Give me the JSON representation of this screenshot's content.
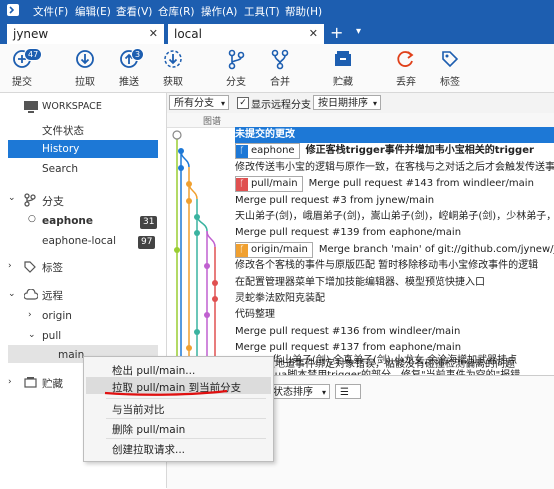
{
  "menubar": {
    "items": [
      "文件(F)",
      "编辑(E)",
      "查看(V)",
      "仓库(R)",
      "操作(A)",
      "工具(T)",
      "帮助(H)"
    ],
    "bg": "#1d5eb0"
  },
  "tabs": [
    {
      "label": "jynew",
      "close": "✕"
    },
    {
      "label": "local",
      "close": "✕"
    }
  ],
  "new_tab": "+",
  "tab_menu": "▾",
  "toolbar": {
    "commit": {
      "label": "提交",
      "badge": "47"
    },
    "pull": {
      "label": "拉取"
    },
    "push": {
      "label": "推送",
      "badge": "3"
    },
    "fetch": {
      "label": "获取"
    },
    "branch": {
      "label": "分支"
    },
    "merge": {
      "label": "合并"
    },
    "stash": {
      "label": "贮藏"
    },
    "discard": {
      "label": "丢弃"
    },
    "tag": {
      "label": "标签"
    }
  },
  "sidebar": {
    "workspace": "WORKSPACE",
    "file_status": "文件状态",
    "history": "History",
    "search": "Search",
    "branches_header": "分支",
    "branches": [
      {
        "name": "eaphone",
        "count": "31"
      },
      {
        "name": "eaphone-local",
        "count": "97"
      }
    ],
    "tags_header": "标签",
    "remotes_header": "远程",
    "remote_origin": "origin",
    "remote_pull": "pull",
    "remote_pull_main": "main",
    "stash_header": "贮藏"
  },
  "filter": {
    "branches": "所有分支",
    "show_remote": "显示远程分支",
    "sort": "按日期排序"
  },
  "columns": {
    "graph": "图谱"
  },
  "commits": [
    {
      "text": "未提交的更改",
      "selected": true
    },
    {
      "ref": "eaphone",
      "text": "修正客栈trigger事件并增加韦小宝相关的trigger",
      "bold": true
    },
    {
      "text": "修改传送韦小宝的逻辑与原作一致，在客栈与之对话之后才会触发传送事件 |"
    },
    {
      "ref": "pull/main",
      "text": "Merge pull request #143 from windleer/main"
    },
    {
      "text": "Merge pull request #3 from jynew/main"
    },
    {
      "text": "天山弟子(剑)，峨眉弟子(剑)，嵩山弟子(剑)，崆峒弟子(剑)，少林弟子，左冷"
    },
    {
      "text": "Merge pull request #139 from eaphone/main"
    },
    {
      "ref": "origin/main",
      "text": "Merge branch 'main' of git://github.com/jynew/jyne"
    },
    {
      "text": "修改各个客栈的事件与原版匹配 暂时移除移动韦小宝修改事件的逻辑"
    },
    {
      "text": "在配置管理器菜单下增加技能编辑器、模型预览快捷入口"
    },
    {
      "text": "灵蛇拳法欧阳克装配"
    },
    {
      "text": "代码整理"
    },
    {
      "text": "Merge pull request #136 from windleer/main"
    },
    {
      "text": "Merge pull request #137 from eaphone/main"
    },
    {
      "text": "修正明教地道事件绑定对象错误，骷髅没有碰撞检测偏离的问题"
    },
    {
      "text": "华山弟子(剑),全真弟子(剑),小龙女,余沧海增加武器挂点"
    },
    {
      "text": "lua脚本禁用trigger的部分，修复\"当前事件为空的\"报错"
    }
  ],
  "bottom": {
    "sort": "状态排序",
    "list": "☰"
  },
  "context_menu": {
    "checkout": "检出 pull/main...",
    "pull_into": "拉取 pull/main 到当前分支",
    "diff": "与当前对比",
    "delete": "删除 pull/main",
    "create_pr": "创建拉取请求..."
  },
  "colors": {
    "accent": "#1d78d6",
    "brand": "#1d5eb0",
    "annotation": "#e01010"
  }
}
